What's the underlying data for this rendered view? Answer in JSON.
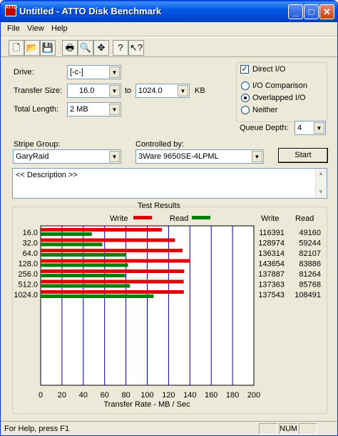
{
  "window": {
    "title": "Untitled - ATTO Disk Benchmark",
    "icon_text": "ATTO"
  },
  "menu": [
    "File",
    "View",
    "Help"
  ],
  "form": {
    "drive_label": "Drive:",
    "drive_value": "[-c-]",
    "transfer_label": "Transfer Size:",
    "transfer_from": "16.0",
    "to_label": "to",
    "transfer_to": "1024.0",
    "kb_label": "KB",
    "length_label": "Total Length:",
    "length_value": "2 MB",
    "direct_io": "Direct I/O",
    "io_comparison": "I/O Comparison",
    "overlapped_io": "Overlapped I/O",
    "neither": "Neither",
    "queue_label": "Queue Depth:",
    "queue_value": "4",
    "stripe_label": "Stripe Group:",
    "stripe_value": "GaryRaid",
    "controlled_label": "Controlled by:",
    "controlled_value": "3Ware 9650SE-4LPML",
    "start_label": "Start",
    "description": "<< Description >>"
  },
  "results": {
    "title": "Test Results",
    "write_header": "Write",
    "read_header": "Read"
  },
  "chart_data": {
    "type": "bar",
    "categories": [
      "16.0",
      "32.0",
      "64.0",
      "128.0",
      "256.0",
      "512.0",
      "1024.0"
    ],
    "series": [
      {
        "name": "Write",
        "color": "#e00000",
        "values": [
          116391,
          128974,
          136314,
          143654,
          137887,
          137363,
          137543
        ]
      },
      {
        "name": "Read",
        "color": "#008000",
        "values": [
          49160,
          59244,
          82107,
          83886,
          81264,
          85768,
          108491
        ]
      }
    ],
    "xlabel": "Transfer Rate - MB / Sec",
    "xlim": [
      0,
      200
    ],
    "xticks": [
      "0",
      "20",
      "40",
      "60",
      "80",
      "100",
      "120",
      "140",
      "160",
      "180",
      "200"
    ],
    "legend": "top"
  },
  "status": {
    "help_text": "For Help, press F1",
    "num": "NUM"
  }
}
